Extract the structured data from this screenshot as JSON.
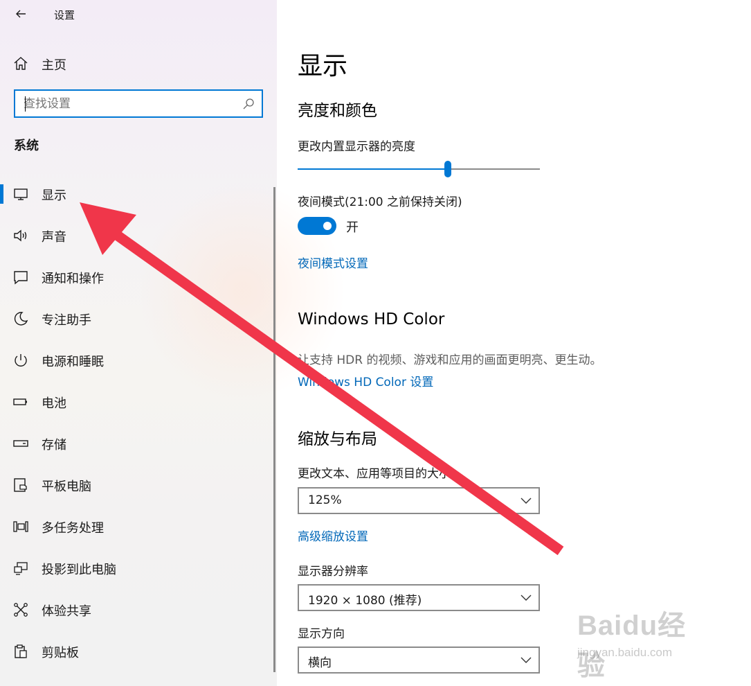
{
  "window": {
    "title": "设置"
  },
  "sidebar": {
    "home_label": "主页",
    "search_placeholder": "查找设置",
    "section_heading": "系统",
    "items": [
      {
        "label": "显示",
        "icon": "monitor-icon",
        "selected": true
      },
      {
        "label": "声音",
        "icon": "speaker-icon",
        "selected": false
      },
      {
        "label": "通知和操作",
        "icon": "notification-icon",
        "selected": false
      },
      {
        "label": "专注助手",
        "icon": "moon-icon",
        "selected": false
      },
      {
        "label": "电源和睡眠",
        "icon": "power-icon",
        "selected": false
      },
      {
        "label": "电池",
        "icon": "battery-icon",
        "selected": false
      },
      {
        "label": "存储",
        "icon": "storage-icon",
        "selected": false
      },
      {
        "label": "平板电脑",
        "icon": "tablet-icon",
        "selected": false
      },
      {
        "label": "多任务处理",
        "icon": "multitasking-icon",
        "selected": false
      },
      {
        "label": "投影到此电脑",
        "icon": "projecting-icon",
        "selected": false
      },
      {
        "label": "体验共享",
        "icon": "shared-experiences-icon",
        "selected": false
      },
      {
        "label": "剪贴板",
        "icon": "clipboard-icon",
        "selected": false
      }
    ]
  },
  "main": {
    "title": "显示",
    "brightness_section": {
      "heading": "亮度和颜色",
      "brightness_label": "更改内置显示器的亮度",
      "brightness_value": 0.62,
      "night_light_label": "夜间模式(21:00 之前保持关闭)",
      "night_light_on": true,
      "night_light_state": "开",
      "night_light_link": "夜间模式设置"
    },
    "hdr_section": {
      "heading": "Windows HD Color",
      "description": "让支持 HDR 的视频、游戏和应用的画面更明亮、更生动。",
      "link": "Windows HD Color 设置"
    },
    "scale_section": {
      "heading": "缩放与布局",
      "scale_label": "更改文本、应用等项目的大小",
      "scale_value": "125%",
      "advanced_scaling_link": "高级缩放设置",
      "resolution_label": "显示器分辨率",
      "resolution_value": "1920 × 1080 (推荐)",
      "orientation_label": "显示方向",
      "orientation_value": "横向"
    }
  },
  "annotation": {
    "arrow_color": "#f0364a"
  },
  "colors": {
    "accent": "#0078d4",
    "link": "#0067b8"
  },
  "watermark": {
    "logo": "Baidu经验",
    "url": "jingyan.baidu.com"
  }
}
